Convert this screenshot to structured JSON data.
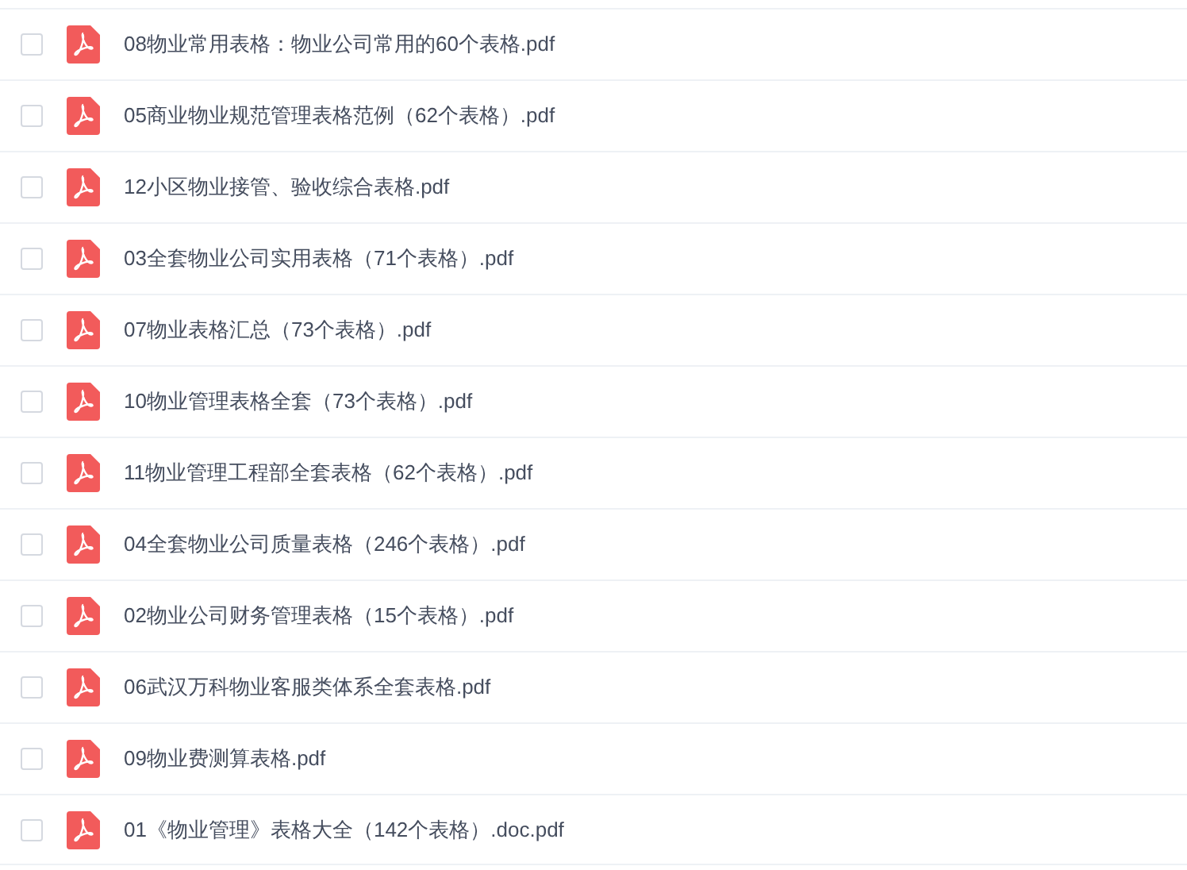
{
  "files": [
    {
      "name": "08物业常用表格：物业公司常用的60个表格.pdf",
      "checked": false
    },
    {
      "name": "05商业物业规范管理表格范例（62个表格）.pdf",
      "checked": false
    },
    {
      "name": "12小区物业接管、验收综合表格.pdf",
      "checked": false
    },
    {
      "name": "03全套物业公司实用表格（71个表格）.pdf",
      "checked": false
    },
    {
      "name": "07物业表格汇总（73个表格）.pdf",
      "checked": false
    },
    {
      "name": "10物业管理表格全套（73个表格）.pdf",
      "checked": false
    },
    {
      "name": "11物业管理工程部全套表格（62个表格）.pdf",
      "checked": false
    },
    {
      "name": "04全套物业公司质量表格（246个表格）.pdf",
      "checked": false
    },
    {
      "name": "02物业公司财务管理表格（15个表格）.pdf",
      "checked": false
    },
    {
      "name": "06武汉万科物业客服类体系全套表格.pdf",
      "checked": false
    },
    {
      "name": "09物业费测算表格.pdf",
      "checked": false
    },
    {
      "name": "01《物业管理》表格大全（142个表格）.doc.pdf",
      "checked": false
    }
  ]
}
